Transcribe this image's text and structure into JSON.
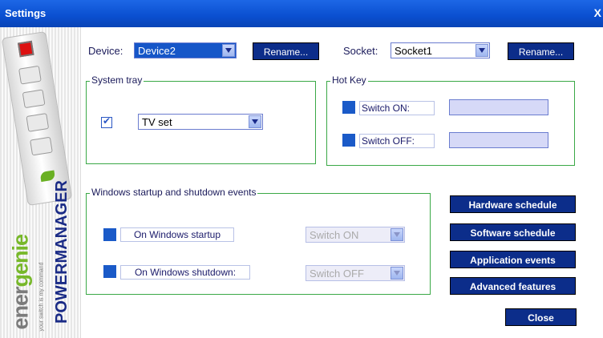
{
  "window": {
    "title": "Settings",
    "close_symbol": "X"
  },
  "branding": {
    "logo_part1": "ener",
    "logo_part2": "genie",
    "tagline": "your switch is my command",
    "product": "POWERMANAGER"
  },
  "device": {
    "label": "Device:",
    "value": "Device2",
    "rename_label": "Rename..."
  },
  "socket": {
    "label": "Socket:",
    "value": "Socket1",
    "rename_label": "Rename..."
  },
  "system_tray": {
    "title": "System tray",
    "checked": true,
    "selected": "TV set"
  },
  "hot_key": {
    "title": "Hot Key",
    "switch_on_label": "Switch ON:",
    "switch_off_label": "Switch OFF:",
    "switch_on_value": "",
    "switch_off_value": ""
  },
  "events": {
    "title": "Windows startup and shutdown events",
    "startup_label": "On Windows startup",
    "startup_action": "Switch ON",
    "shutdown_label": "On Windows shutdown:",
    "shutdown_action": "Switch OFF"
  },
  "buttons": {
    "hardware_schedule": "Hardware schedule",
    "software_schedule": "Software schedule",
    "application_events": "Application events",
    "advanced_features": "Advanced features",
    "close": "Close"
  },
  "colors": {
    "titlebar": "#0a4fd0",
    "button": "#0c2d8a",
    "group_border": "#3aa846",
    "accent_green": "#77b82a"
  }
}
